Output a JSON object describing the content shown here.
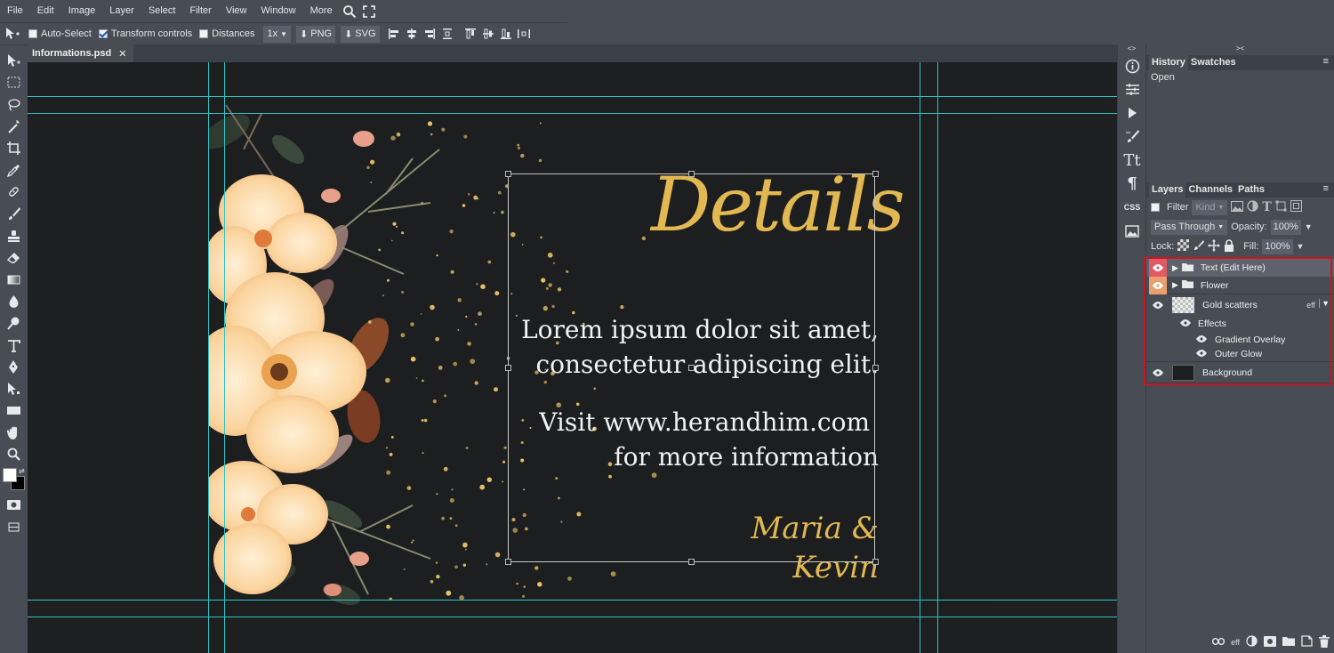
{
  "menu": [
    "File",
    "Edit",
    "Image",
    "Layer",
    "Select",
    "Filter",
    "View",
    "Window",
    "More"
  ],
  "options": {
    "auto_select_label": "Auto-Select",
    "transform_controls_label": "Transform controls",
    "distances_label": "Distances",
    "scale_value": "1x",
    "png_label": "PNG",
    "svg_label": "SVG"
  },
  "document": {
    "tab_name": "Informations.psd",
    "close_glyph": "✕"
  },
  "artwork": {
    "title": "Details",
    "body_line1": "Lorem ipsum dolor sit amet,",
    "body_line2": "consectetur adipiscing elit.",
    "visit_line1": "Visit www.herandhim.com",
    "visit_line2": "for more information",
    "signature": "Maria & Kevin",
    "colors": {
      "gold": "#e8c56a",
      "background": "#1d1e1f",
      "guide": "#2ec4c4"
    }
  },
  "history_panel": {
    "tabs": [
      "History",
      "Swatches"
    ],
    "items": [
      "Open"
    ]
  },
  "layers_panel": {
    "tabs": [
      "Layers",
      "Channels",
      "Paths"
    ],
    "filter_label": "Filter",
    "kind_label": "Kind",
    "blend_mode": "Pass Through",
    "opacity_label": "Opacity:",
    "opacity_value": "100%",
    "lock_label": "Lock:",
    "fill_label": "Fill:",
    "fill_value": "100%",
    "layers": [
      {
        "name": "Text (Edit Here)",
        "type": "group",
        "eye_color": "#e05a66"
      },
      {
        "name": "Flower",
        "type": "group",
        "eye_color": "#e8a070"
      },
      {
        "name": "Gold scatters",
        "type": "pixel",
        "eff_label": "eff"
      },
      {
        "name": "Effects",
        "type": "effects"
      },
      {
        "name": "Gradient Overlay",
        "type": "effect"
      },
      {
        "name": "Outer Glow",
        "type": "effect"
      },
      {
        "name": "Background",
        "type": "pixel"
      }
    ],
    "bottom_eff": "eff",
    "highlight_color": "#d0141e"
  },
  "icon_column": {
    "css_label": "CSS"
  }
}
